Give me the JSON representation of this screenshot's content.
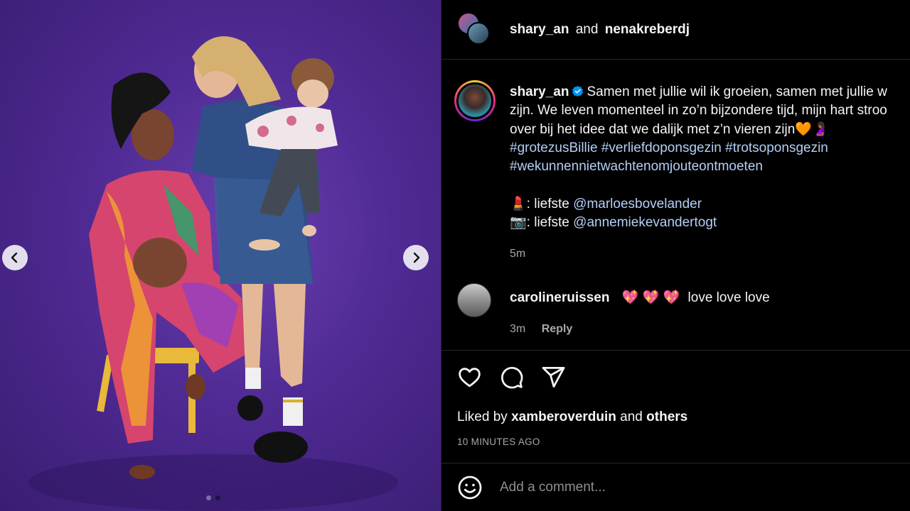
{
  "header": {
    "user1": "shary_an",
    "and_text": "and",
    "user2": "nenakreberdj"
  },
  "caption": {
    "username": "shary_an",
    "lines": [
      "Samen met jullie wil ik groeien, samen met jullie w",
      "zijn. We leven momenteel in zo’n bijzondere tijd, mijn hart stroo",
      "over bij het idee dat we dalijk met z’n vieren zijn"
    ],
    "line3_emojis": "🧡🤰🏾",
    "hashtags": [
      "#grotezusBillie",
      "#verliefdoponsgezin",
      "#trotsoponsgezin",
      "#wekunnennietwachtenomjouteontmoeten"
    ],
    "credit1_emoji": "💄",
    "credit1_text": ": liefste",
    "credit1_mention": "@marloesbovelander",
    "credit2_emoji": "📷",
    "credit2_text": ": liefste",
    "credit2_mention": "@annemiekevandertogt",
    "time": "5m"
  },
  "comment": {
    "username": "carolineruissen",
    "emojis": "💖 💖 💖",
    "text": "love love love",
    "time": "3m",
    "reply_label": "Reply"
  },
  "likes": {
    "prefix": "Liked by",
    "user": "xamberoverduin",
    "and_text": "and",
    "others": "others"
  },
  "posted_ago": "10 MINUTES AGO",
  "add_comment": {
    "placeholder": "Add a comment..."
  },
  "carousel": {
    "total_slides": 2,
    "active_slide": 2
  },
  "colors": {
    "background": "#000000",
    "text": "#f5f5f5",
    "muted": "#a8a8a8",
    "link": "#b3cff5",
    "verified": "#0095f6",
    "photo_backdrop": "#4f2a93"
  }
}
